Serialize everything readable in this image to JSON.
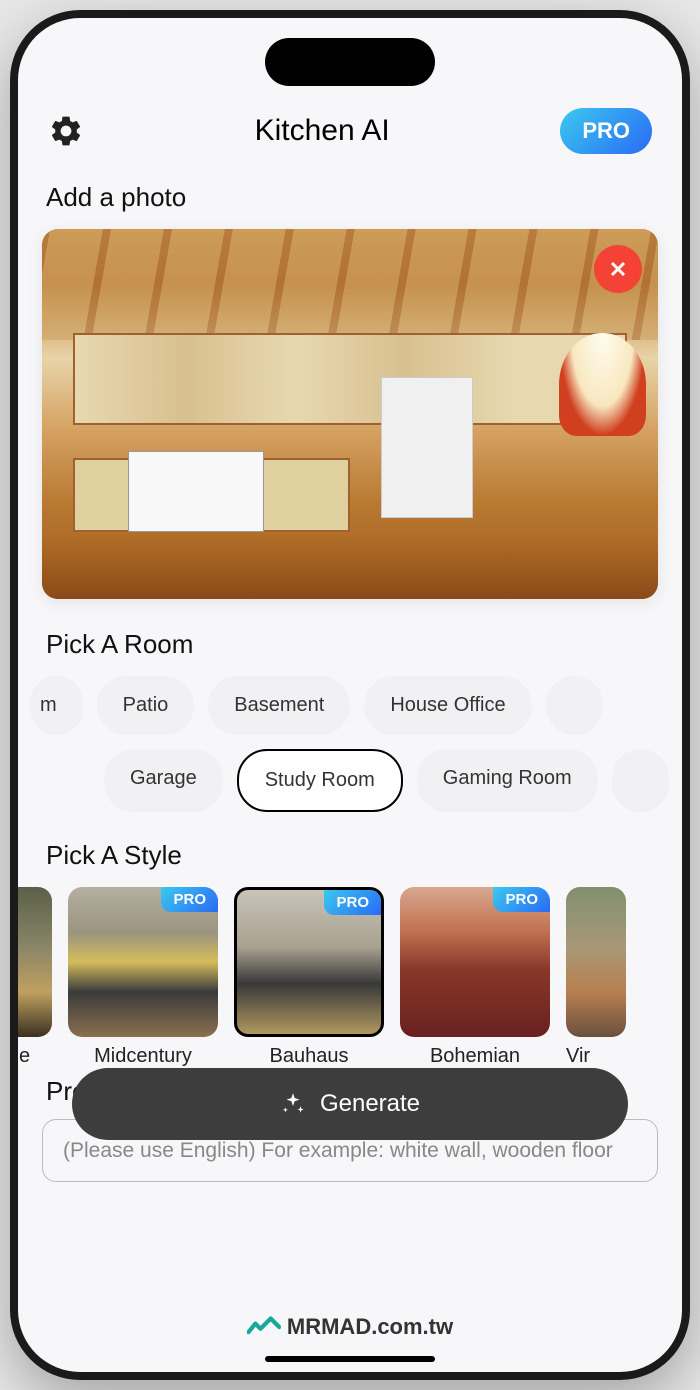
{
  "header": {
    "title": "Kitchen AI",
    "pro_label": "PRO"
  },
  "photo": {
    "section_title": "Add a photo"
  },
  "room": {
    "section_title": "Pick A Room",
    "row1": [
      "m",
      "Patio",
      "Basement",
      "House Office"
    ],
    "row2": [
      "Garage",
      "Study Room",
      "Gaming Room"
    ],
    "selected": "Study Room"
  },
  "style": {
    "section_title": "Pick A Style",
    "items": [
      {
        "label": "e",
        "pro": false
      },
      {
        "label": "Midcentury",
        "pro": true
      },
      {
        "label": "Bauhaus",
        "pro": true
      },
      {
        "label": "Bohemian",
        "pro": true
      },
      {
        "label": "Vir",
        "pro": false
      }
    ],
    "selected": "Bauhaus",
    "pro_tag": "PRO"
  },
  "prompt": {
    "section_title_partial": "Pro",
    "placeholder": "(Please use English) For example: white wall, wooden floor"
  },
  "generate": {
    "label": "Generate"
  },
  "watermark": {
    "text": "MRMAD.com.tw"
  }
}
